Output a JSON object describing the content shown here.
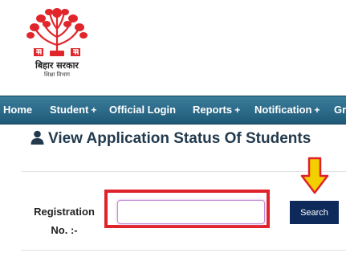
{
  "header": {
    "logo": {
      "title": "बिहार सरकार",
      "subtitle": "शिक्षा विभाग",
      "icon": "bihar-government-emblem",
      "color": "#e0262b"
    }
  },
  "nav": {
    "bar_color": "#2b6a88",
    "items": [
      {
        "label": "Home",
        "submenu": false,
        "marker": ""
      },
      {
        "label": "Student",
        "submenu": true,
        "marker": "+"
      },
      {
        "label": "Official Login",
        "submenu": false,
        "marker": ""
      },
      {
        "label": "Reports",
        "submenu": true,
        "marker": "+"
      },
      {
        "label": "Notification",
        "submenu": true,
        "marker": "+"
      },
      {
        "label": "Gr",
        "submenu": false,
        "marker": ""
      }
    ]
  },
  "main": {
    "title": "View Application Status Of Students",
    "title_icon": "user-icon",
    "form": {
      "registration_label": "Registration No. :-",
      "registration_label_line1": "Registration",
      "registration_label_line2": "No. :-",
      "registration_value": "",
      "registration_placeholder": "",
      "search_label": "Search"
    },
    "highlight_color": "#e0222a",
    "arrow_color": "#f2d000",
    "button_color": "#0e2a5a"
  }
}
